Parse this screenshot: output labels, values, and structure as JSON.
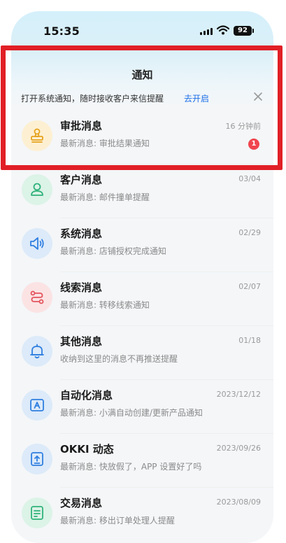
{
  "status_bar": {
    "time": "15:35",
    "battery": "92"
  },
  "header": {
    "title": "通知"
  },
  "notice": {
    "text": "打开系统通知，随时接收客户来信提醒",
    "action": "去开启"
  },
  "colors": {
    "highlight": "#e11f26",
    "link": "#1c6fe8",
    "badge": "#f0454f"
  },
  "items": [
    {
      "title": "审批消息",
      "subtitle": "最新消息: 审批结果通知",
      "date": "16 分钟前",
      "badge": "1",
      "icon": "stamp-icon"
    },
    {
      "title": "客户消息",
      "subtitle": "最新消息: 邮件撞单提醒",
      "date": "03/04",
      "icon": "person-icon"
    },
    {
      "title": "系统消息",
      "subtitle": "最新消息: 店铺授权完成通知",
      "date": "02/29",
      "icon": "speaker-icon"
    },
    {
      "title": "线索消息",
      "subtitle": "最新消息: 转移线索通知",
      "date": "02/07",
      "icon": "route-icon"
    },
    {
      "title": "其他消息",
      "subtitle": "收纳到这里的消息不再推送提醒",
      "date": "01/18",
      "icon": "bell-icon"
    },
    {
      "title": "自动化消息",
      "subtitle": "最新消息: 小满自动创建/更新产品通知",
      "date": "2023/12/12",
      "icon": "auto-icon"
    },
    {
      "title": "OKKI 动态",
      "subtitle": "最新消息: 快放假了，APP 设置好了吗",
      "date": "2023/09/26",
      "icon": "upload-icon"
    },
    {
      "title": "交易消息",
      "subtitle": "最新消息: 移出订单处理人提醒",
      "date": "2023/08/09",
      "icon": "document-icon"
    }
  ]
}
